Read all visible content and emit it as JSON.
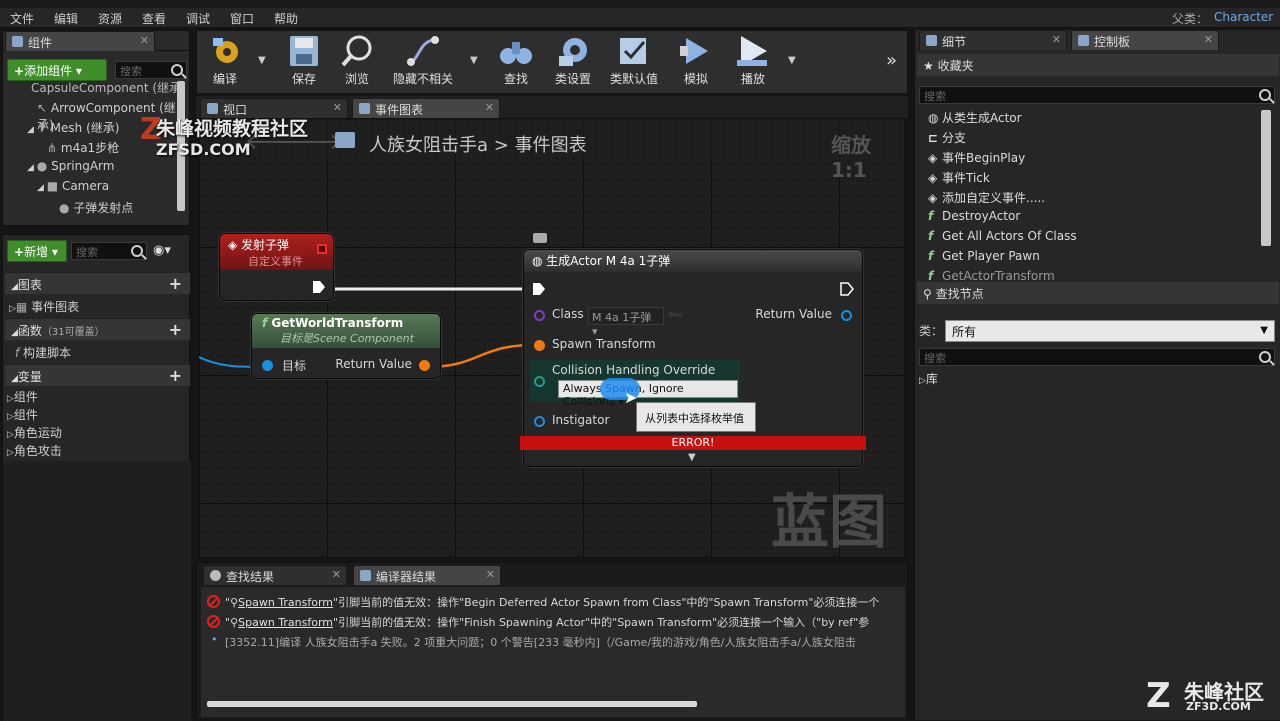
{
  "menubar": {
    "items": [
      "文件",
      "编辑",
      "资源",
      "查看",
      "调试",
      "窗口",
      "帮助"
    ],
    "parent_label": "父类：",
    "parent_value": "Character"
  },
  "components_panel": {
    "tab": "组件",
    "add_button": "添加组件 ▾",
    "search_placeholder": "搜索",
    "tree": [
      "CapsuleComponent (继承)",
      "ArrowComponent (继承)",
      "Mesh (继承)",
      "m4a1步枪",
      "SpringArm",
      "Camera",
      "子弹发射点"
    ]
  },
  "my_blueprint": {
    "add_button": "新增 ▾",
    "search_placeholder": "搜索",
    "sections": {
      "graphs": "图表",
      "event_graph": "事件图表",
      "functions": "函数",
      "functions_count": "（31可覆盖）",
      "construction_script": "构建脚本",
      "variables": "变量"
    },
    "variable_groups": [
      "组件",
      "组件",
      "角色运动",
      "角色攻击"
    ]
  },
  "toolbar": {
    "buttons": [
      "编译",
      "保存",
      "浏览",
      "隐藏不相关",
      "查找",
      "类设置",
      "类默认值",
      "模拟",
      "播放"
    ]
  },
  "editor_tabs": {
    "viewport": "视口",
    "event_graph": "事件图表"
  },
  "graph": {
    "breadcrumb_root": "人族女阻击手a",
    "breadcrumb_sep": ">",
    "breadcrumb_current": "事件图表",
    "zoom": "缩放1:1",
    "watermark": "蓝图",
    "event_node": {
      "title": "发射子弹",
      "subtitle": "自定义事件"
    },
    "func_node": {
      "title": "GetWorldTransform",
      "subtitle": "目标是Scene Component",
      "pin_target": "目标",
      "pin_return": "Return Value"
    },
    "spawn_node": {
      "title": "生成Actor M 4a 1子弹",
      "pin_class": "Class",
      "class_value": "M 4a 1子弹 ▾",
      "pin_return": "Return Value",
      "pin_spawn_transform": "Spawn Transform",
      "pin_collision": "Collision Handling Override",
      "collision_value": "Always Spawn, Ignore Collisions ▾",
      "pin_instigator": "Instigator",
      "error": "ERROR!",
      "tooltip": "从列表中选择枚举值"
    }
  },
  "output_tabs": {
    "find_results": "查找结果",
    "compiler_results": "编译器结果"
  },
  "compiler_log": [
    {
      "type": "error",
      "prefix": "\"",
      "link": "Spawn Transform",
      "text": "\"引脚当前的值无效：操作\"Begin Deferred Actor Spawn from Class\"中的\"Spawn Transform\"必须连接一个"
    },
    {
      "type": "error",
      "prefix": "\"",
      "link": "Spawn Transform",
      "text": "\"引脚当前的值无效：操作\"Finish Spawning Actor\"中的\"Spawn Transform\"必须连接一个输入（\"by ref\"参"
    },
    {
      "type": "info",
      "text": "[3352.11]编译 人族女阻击手a 失败。2 项重大问题；0 个警告[233 毫秒内]（/Game/我的游戏/角色/人族女阻击手a/人族女阻击"
    }
  ],
  "right_panel": {
    "details_tab": "细节",
    "palette_tab": "控制板",
    "favorites": "收藏夹",
    "search_placeholder": "搜索",
    "favorites_items": [
      "从类生成Actor",
      "分支",
      "事件BeginPlay",
      "事件Tick",
      "添加自定义事件.....",
      "DestroyActor",
      "Get All Actors Of Class",
      "Get Player Pawn",
      "GetActorTransform"
    ],
    "find_node": "查找节点",
    "class_label": "类：",
    "class_value": "所有",
    "search2_placeholder": "搜索",
    "library": "库"
  },
  "watermarks": {
    "top_cn": "朱峰视频教程社区",
    "top_en": "ZFSD.COM",
    "bottom_cn": "朱峰社区",
    "bottom_en": "ZF3D.COM"
  }
}
